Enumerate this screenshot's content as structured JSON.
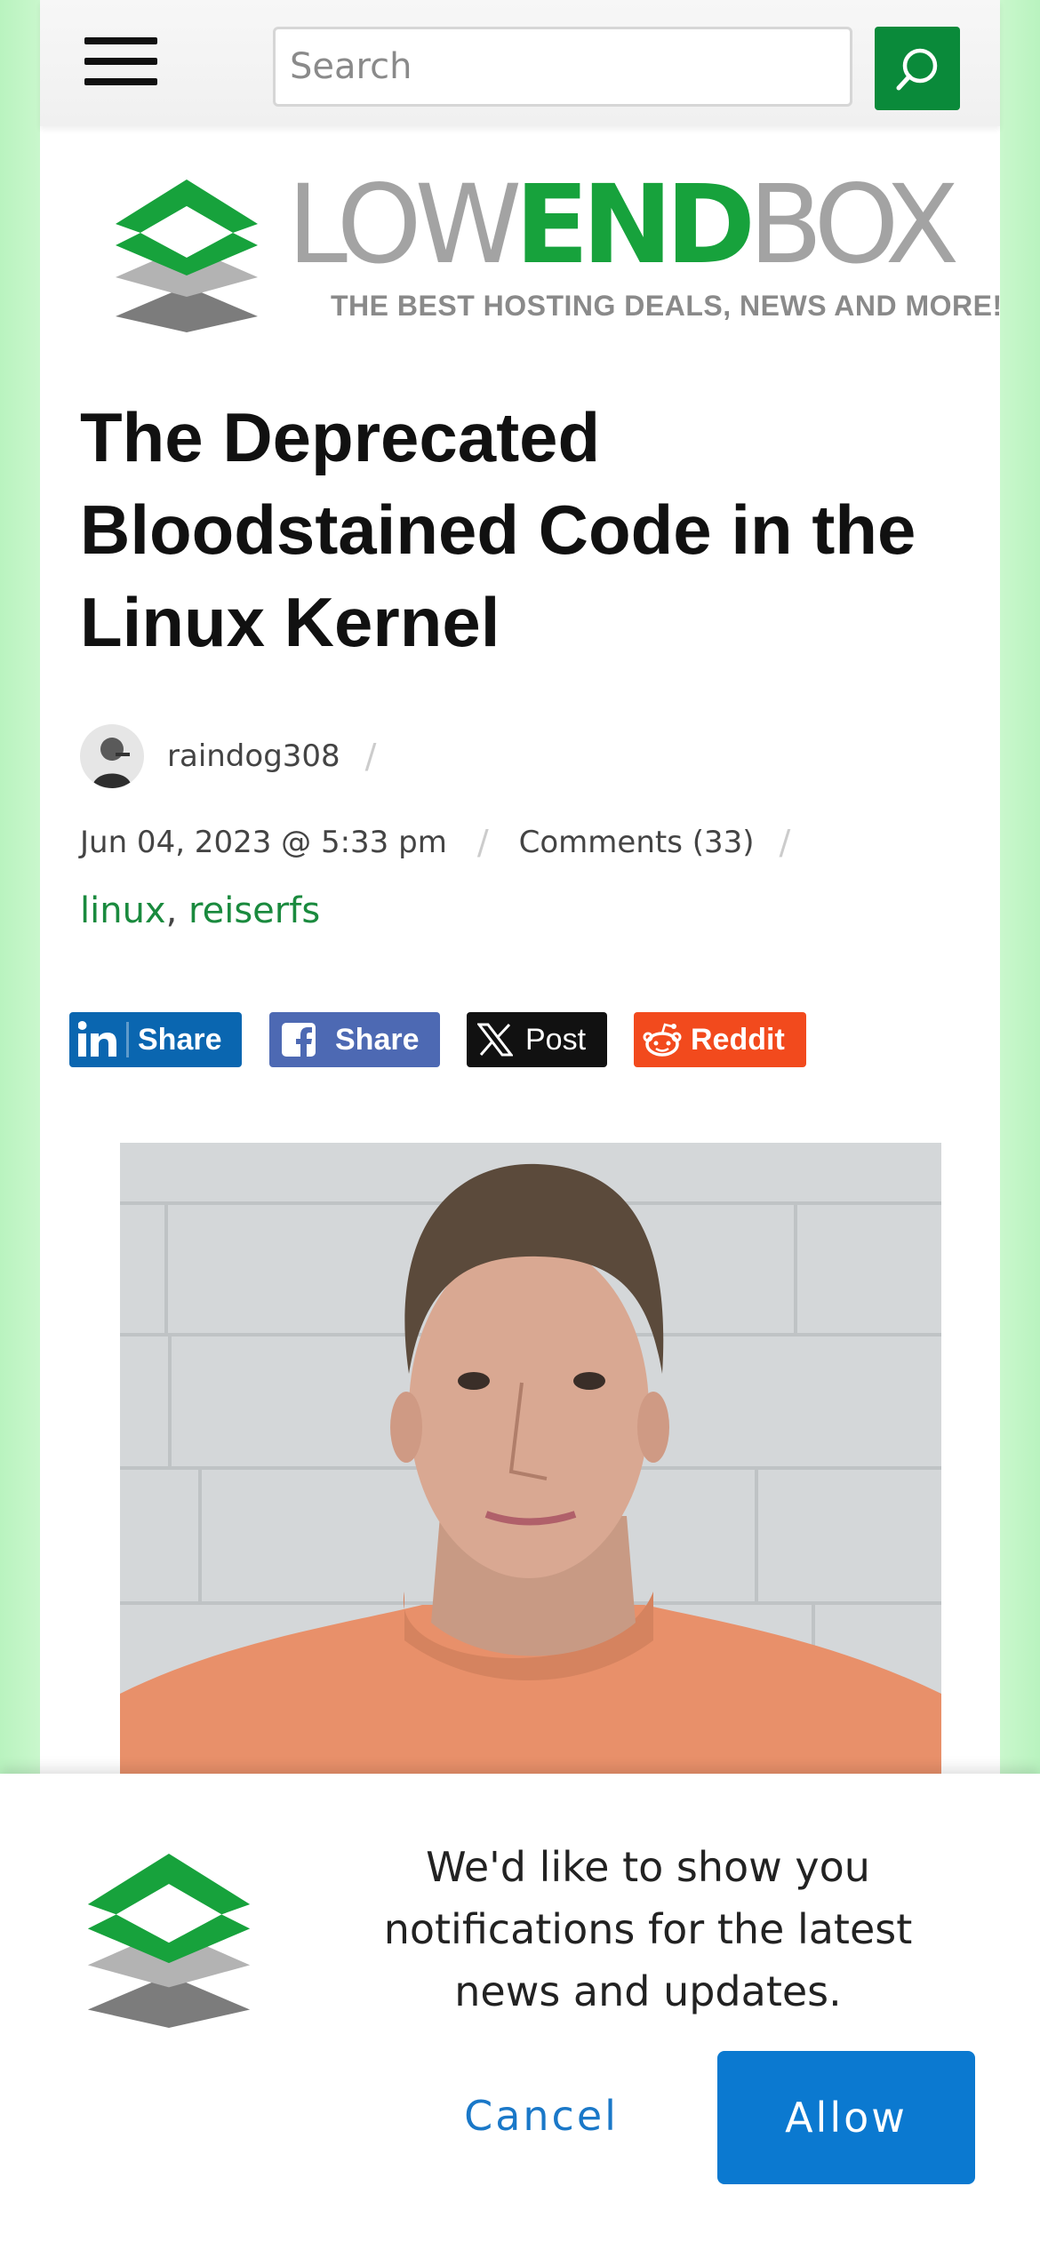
{
  "header": {
    "search_placeholder": "Search",
    "menu_icon": "hamburger-menu-icon",
    "search_icon": "search-icon"
  },
  "logo": {
    "low": "LOW",
    "end": "END",
    "box": "BOX",
    "tagline": "THE BEST HOSTING DEALS, NEWS AND MORE!"
  },
  "article": {
    "title": "The Deprecated Bloodstained Code in the Linux Kernel",
    "author": "raindog308",
    "date": "Jun 04, 2023 @ 5:33 pm",
    "comments": "Comments (33)",
    "tags": [
      "linux",
      "reiserfs"
    ],
    "separator": "/"
  },
  "share": {
    "linkedin_label": "Share",
    "facebook_label": "Share",
    "x_label": "Post",
    "reddit_label": "Reddit"
  },
  "notification": {
    "message": "We'd like to show you notifications for the latest news and updates.",
    "cancel_label": "Cancel",
    "allow_label": "Allow"
  },
  "colors": {
    "brand_green": "#17a23c",
    "link_green": "#1a8a3e",
    "allow_blue": "#0b79d0",
    "linkedin": "#0a66b0",
    "facebook": "#4d69b3",
    "reddit": "#f24a1d"
  }
}
